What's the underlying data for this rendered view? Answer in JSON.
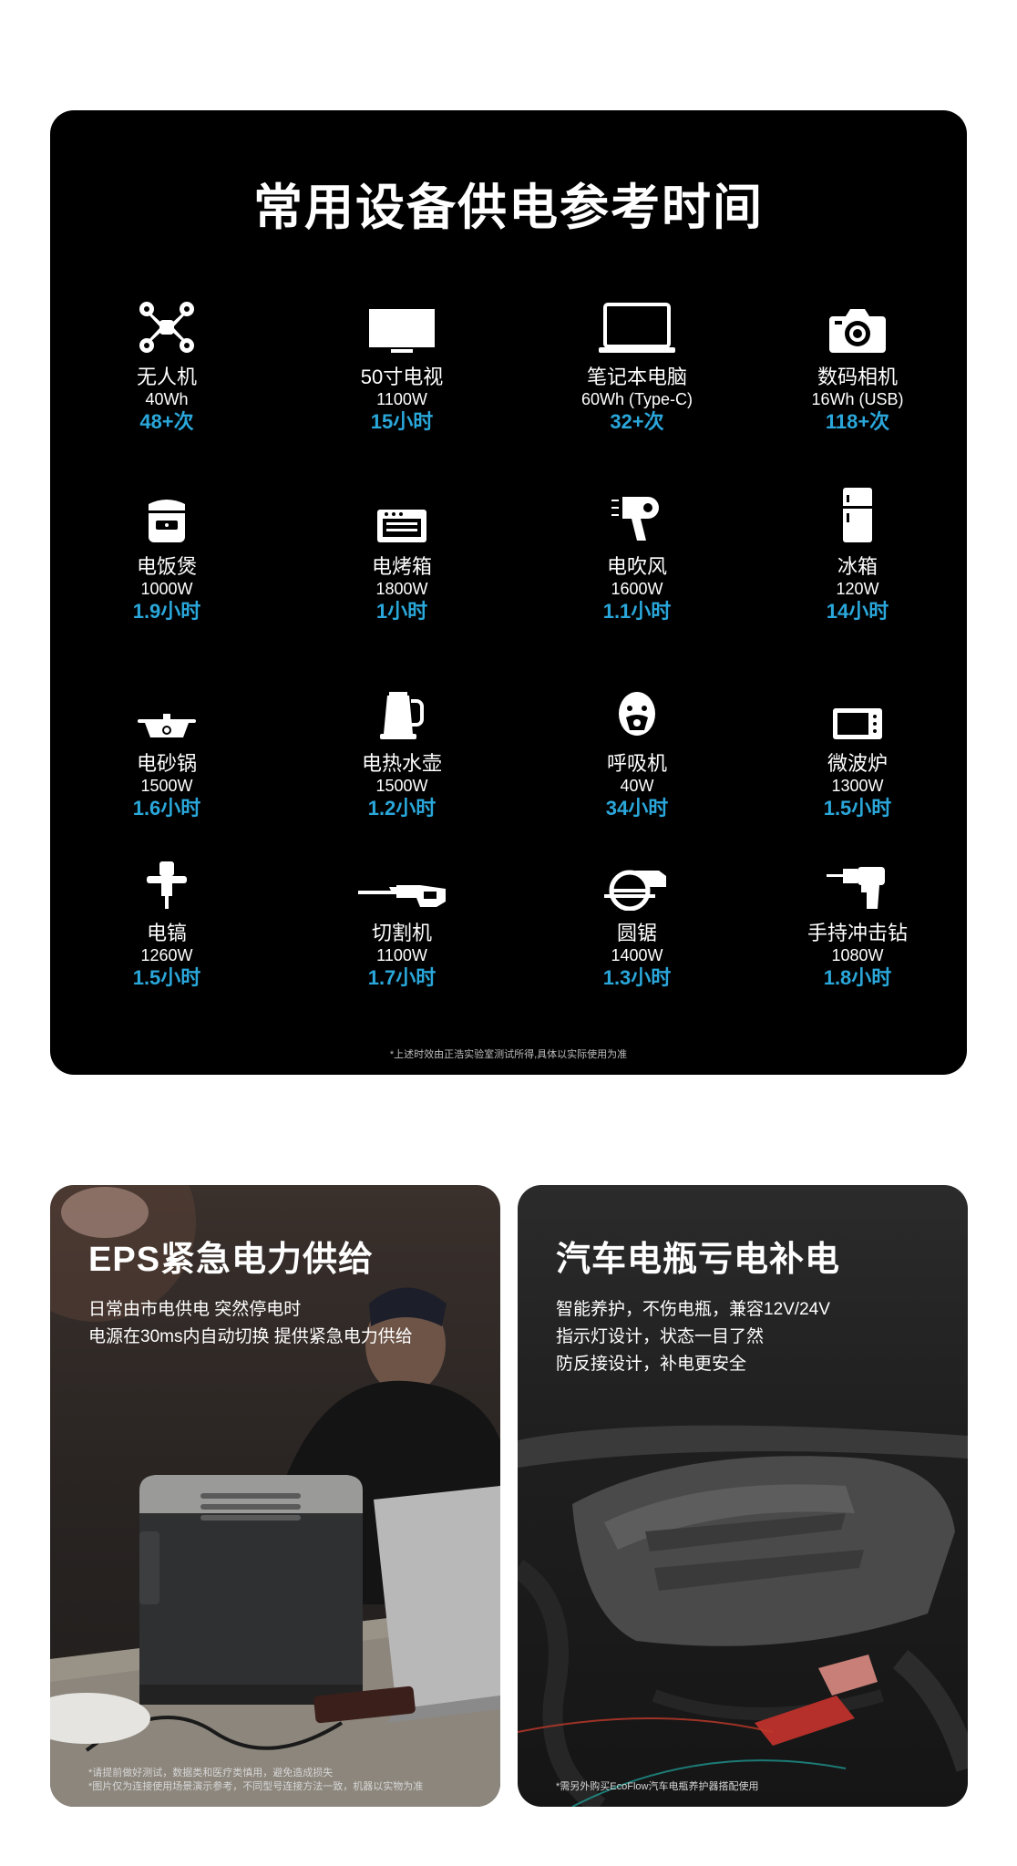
{
  "runtime_panel": {
    "title": "常用设备供电参考时间",
    "note": "*上述时效由正浩实验室测试所得,具体以实际使用为准",
    "devices": [
      {
        "name": "无人机",
        "spec": "40Wh",
        "runtime": "48+次",
        "icon": "drone-icon"
      },
      {
        "name": "50寸电视",
        "spec": "1100W",
        "runtime": "15小时",
        "icon": "tv-icon"
      },
      {
        "name": "笔记本电脑",
        "spec": "60Wh (Type-C)",
        "runtime": "32+次",
        "icon": "laptop-icon"
      },
      {
        "name": "数码相机",
        "spec": "16Wh (USB)",
        "runtime": "118+次",
        "icon": "camera-icon"
      },
      {
        "name": "电饭煲",
        "spec": "1000W",
        "runtime": "1.9小时",
        "icon": "rice-cooker-icon"
      },
      {
        "name": "电烤箱",
        "spec": "1800W",
        "runtime": "1小时",
        "icon": "oven-icon"
      },
      {
        "name": "电吹风",
        "spec": "1600W",
        "runtime": "1.1小时",
        "icon": "hair-dryer-icon"
      },
      {
        "name": "冰箱",
        "spec": "120W",
        "runtime": "14小时",
        "icon": "fridge-icon"
      },
      {
        "name": "电砂锅",
        "spec": "1500W",
        "runtime": "1.6小时",
        "icon": "casserole-icon"
      },
      {
        "name": "电热水壶",
        "spec": "1500W",
        "runtime": "1.2小时",
        "icon": "kettle-icon"
      },
      {
        "name": "呼吸机",
        "spec": "40W",
        "runtime": "34小时",
        "icon": "ventilator-icon"
      },
      {
        "name": "微波炉",
        "spec": "1300W",
        "runtime": "1.5小时",
        "icon": "microwave-icon"
      },
      {
        "name": "电镐",
        "spec": "1260W",
        "runtime": "1.5小时",
        "icon": "electric-pick-icon"
      },
      {
        "name": "切割机",
        "spec": "1100W",
        "runtime": "1.7小时",
        "icon": "reciprocating-saw-icon"
      },
      {
        "name": "圆锯",
        "spec": "1400W",
        "runtime": "1.3小时",
        "icon": "circular-saw-icon"
      },
      {
        "name": "手持冲击钻",
        "spec": "1080W",
        "runtime": "1.8小时",
        "icon": "impact-drill-icon"
      }
    ]
  },
  "eps_card": {
    "title": "EPS紧急电力供给",
    "lines": [
      "日常由市电供电 突然停电时",
      "电源在30ms内自动切换 提供紧急电力供给"
    ],
    "footnotes": [
      "*请提前做好测试，数据类和医疗类慎用，避免造成损失",
      "*图片仅为连接使用场景演示参考，不同型号连接方法一致，机器以实物为准"
    ]
  },
  "car_card": {
    "title": "汽车电瓶亏电补电",
    "lines": [
      "智能养护，不伤电瓶，兼容12V/24V",
      "指示灯设计，状态一目了然",
      "防反接设计，补电更安全"
    ],
    "footnote": "*需另外购买EcoFlow汽车电瓶养护器搭配使用"
  },
  "colors": {
    "accent": "#2aa7da",
    "panel_bg": "#000000",
    "page_bg": "#ffffff"
  }
}
